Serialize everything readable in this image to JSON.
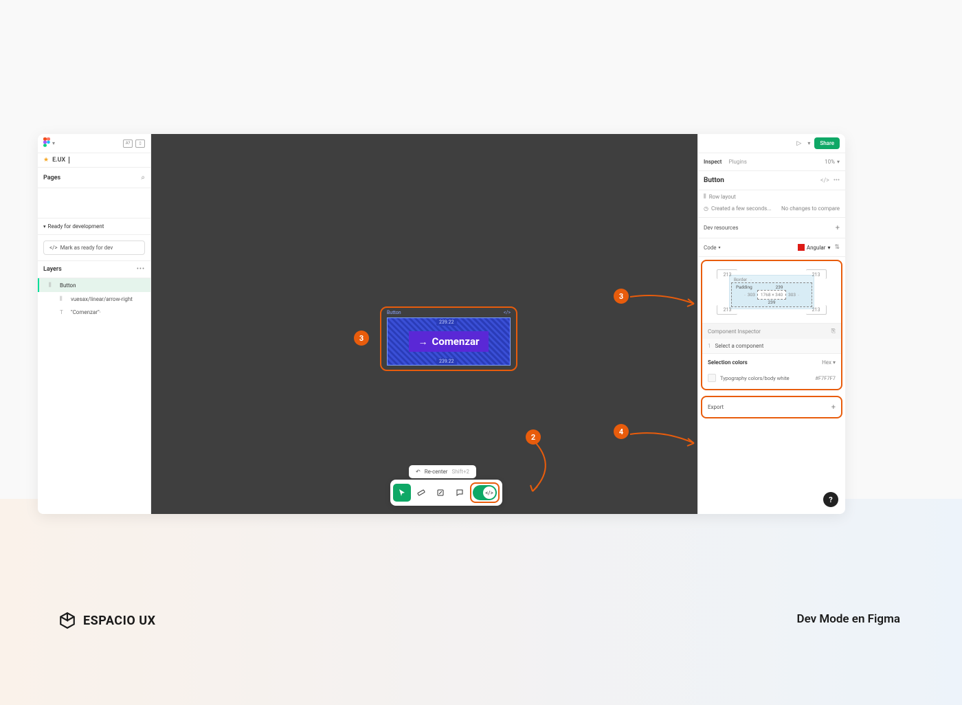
{
  "leftPanel": {
    "fileName": "E.UX",
    "pagesLabel": "Pages",
    "readySection": "Ready for development",
    "markReadyBtn": "Mark as ready for dev",
    "layersLabel": "Layers",
    "layers": [
      {
        "icon": "⫼",
        "name": "Button"
      },
      {
        "icon": "⫼",
        "name": "vuesax/linear/arrow-right"
      },
      {
        "icon": "T",
        "name": "\"Comenzar\"·"
      }
    ]
  },
  "canvas": {
    "frameLabel": "Button",
    "frameDevIcon": "</>",
    "measureTop": "239.22",
    "measureBottom": "239.22",
    "componentText": "Comenzar",
    "recenter": {
      "label": "Re-center",
      "shortcut": "Shift+2"
    },
    "callouts": {
      "c2": "2",
      "c3": "3",
      "c4": "4"
    }
  },
  "rightPanel": {
    "shareBtn": "Share",
    "tabs": {
      "inspect": "Inspect",
      "plugins": "Plugins"
    },
    "zoom": "10%",
    "selectionName": "Button",
    "layoutType": "Row layout",
    "created": "Created a few seconds...",
    "noChanges": "No changes to compare",
    "devResources": "Dev resources",
    "codeDropdown": "Code",
    "frameworkDropdown": "Angular",
    "boxModel": {
      "corners": "213",
      "borderLabel": "Border",
      "borderDash": "-",
      "paddingLabel": "Padding",
      "padTop": "239",
      "padLeft": "303",
      "padRight": "303",
      "padBottom": "239",
      "content": "1768 × 340"
    },
    "componentInspector": "Component Inspector",
    "codeLine": "Select a component",
    "selectionColors": "Selection colors",
    "hexLabel": "Hex",
    "colorName": "Typography colors/body white",
    "colorHex": "#F7F7F7",
    "exportLabel": "Export"
  },
  "footer": {
    "brand": "ESPACIO UX",
    "subtitle": "Dev Mode en Figma"
  }
}
